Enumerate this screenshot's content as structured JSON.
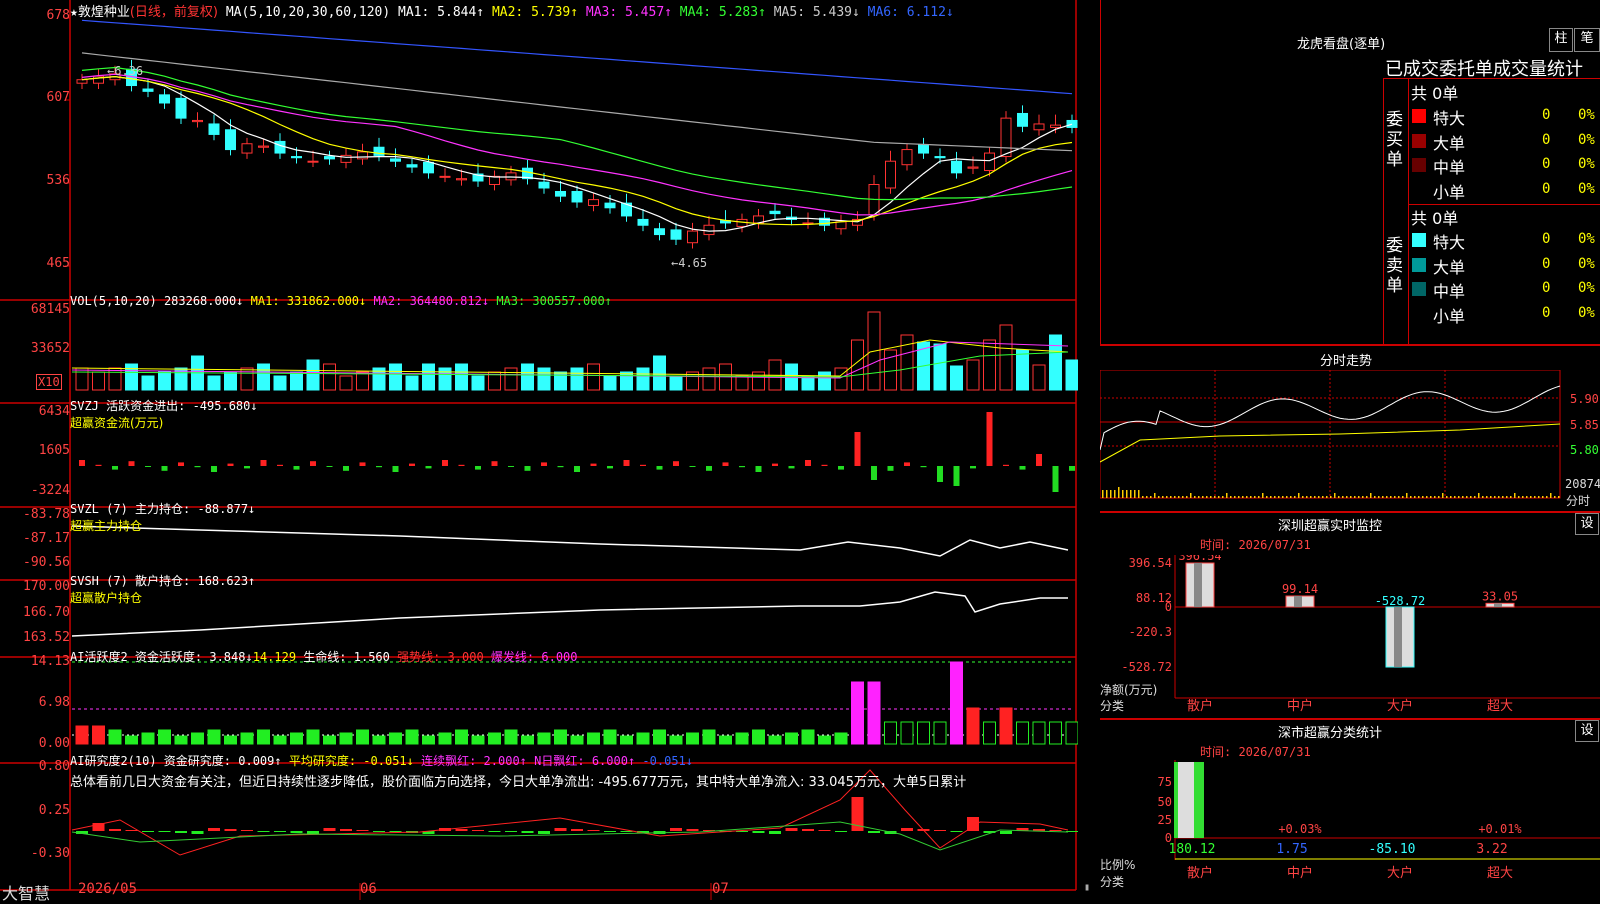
{
  "main": {
    "header": {
      "star": "★",
      "stock": "敦煌种业",
      "mode": "(日线，前复权)",
      "ma_params": "MA(5,10,20,30,60,120)",
      "ma1": "MA1: 5.844↑",
      "ma2": "MA2: 5.739↑",
      "ma3": "MA3: 5.457↑",
      "ma4": "MA4: 5.283↑",
      "ma5": "MA5: 5.439↓",
      "ma6": "MA6: 6.112↓"
    },
    "y_labels": [
      "678",
      "607",
      "536",
      "465"
    ],
    "high_marker": "←6.36",
    "low_marker": "←4.65"
  },
  "vol": {
    "params": "VOL(5,10,20)",
    "value": "283268.000↓",
    "ma1": "MA1: 331862.000↓",
    "ma2": "MA2: 364480.812↓",
    "ma3": "MA3: 300557.000↑",
    "y_labels": [
      "68145",
      "33652"
    ],
    "unit": "X10"
  },
  "svzj": {
    "line1": "SVZJ  活跃资金进出: -495.680↓",
    "line2": "超赢资金流(万元)",
    "y_labels": [
      "6434",
      "1605",
      "-3224"
    ]
  },
  "svzl": {
    "line1": "SVZL (7) 主力持仓: -88.877↓",
    "line2": "超赢主力持仓",
    "y_labels": [
      "-83.78",
      "-87.17",
      "-90.56"
    ]
  },
  "svsh": {
    "line1": "SVSH (7) 散户持仓: 168.623↑",
    "line2": "超赢散户持仓",
    "y_labels": [
      "170.00",
      "166.70",
      "163.52"
    ]
  },
  "ai_active": {
    "title": "AI活跃度2 资金活跃度: 3.848↓",
    "v2": "14.129",
    "life": "生命线: 1.560",
    "strong": "强势线: 3.000",
    "burst": "爆发线: 6.000",
    "y_labels": [
      "14.13",
      "6.98",
      "0.00"
    ]
  },
  "ai_research": {
    "title": "AI研究度2(10) 资金研究度: 0.009↑",
    "avg": "平均研究度: -0.051↓",
    "consec": "连续飘红: 2.000↑",
    "nday": "N日飘红: 6.000↑",
    "extra": "-0.051↓",
    "summary": "总体看前几日大资金有关注，但近日持续性逐步降低，股价面临方向选择，今日大单净流出: -495.677万元，其中特大单净流入: 33.045万元，大单5日累计",
    "y_labels": [
      "0.80",
      "0.25",
      "-0.30"
    ]
  },
  "xaxis": {
    "brand": "大智慧",
    "months": [
      "2026/05",
      "06",
      "07"
    ]
  },
  "dragon": {
    "title": "龙虎看盘(逐单)",
    "btn1": "柱",
    "btn2": "笔",
    "subtitle": "已成交委托单成交量统计",
    "buy": {
      "side_label": "委买单",
      "total": "共 0单",
      "rows": [
        {
          "name": "特大",
          "count": "0",
          "pct": "0%",
          "color": "#ff0000"
        },
        {
          "name": "大单",
          "count": "0",
          "pct": "0%",
          "color": "#990000"
        },
        {
          "name": "中单",
          "count": "0",
          "pct": "0%",
          "color": "#660000"
        },
        {
          "name": "小单",
          "count": "0",
          "pct": "0%",
          "color": "#000000"
        }
      ]
    },
    "sell": {
      "side_label": "委卖单",
      "total": "共 0单",
      "rows": [
        {
          "name": "特大",
          "count": "0",
          "pct": "0%",
          "color": "#33ffff"
        },
        {
          "name": "大单",
          "count": "0",
          "pct": "0%",
          "color": "#009999"
        },
        {
          "name": "中单",
          "count": "0",
          "pct": "0%",
          "color": "#006666"
        },
        {
          "name": "小单",
          "count": "0",
          "pct": "0%",
          "color": "#000000"
        }
      ]
    }
  },
  "intraday": {
    "title": "分时走势",
    "prices": [
      "5.90",
      "5.85",
      "5.80"
    ],
    "vol_label": "20874",
    "vol_unit": "分时"
  },
  "sz_monitor": {
    "title": "深圳超赢实时监控",
    "btn": "设",
    "time": "时间: 2026/07/31",
    "y_labels": [
      "396.54",
      "88.12",
      "0",
      "-220.3",
      "-528.72"
    ],
    "axis_label": "净额(万元)",
    "cat_label": "分类",
    "bars": [
      {
        "name": "散户",
        "value": 396.54,
        "label": "396.54"
      },
      {
        "name": "中户",
        "value": 99.14,
        "label": "99.14"
      },
      {
        "name": "大户",
        "value": -528.72,
        "label": "-528.72"
      },
      {
        "name": "超大",
        "value": 33.05,
        "label": "33.05"
      }
    ]
  },
  "sz_class": {
    "title": "深市超赢分类统计",
    "btn": "设",
    "time": "时间: 2026/07/31",
    "y_labels": [
      "75",
      "50",
      "25",
      "0"
    ],
    "axis_label": "比例%",
    "cat_label": "分类",
    "cats": [
      {
        "name": "散户",
        "top": "",
        "bottom": "180.12"
      },
      {
        "name": "中户",
        "top": "+0.03%",
        "bottom": "1.75"
      },
      {
        "name": "大户",
        "top": "",
        "bottom": "-85.10"
      },
      {
        "name": "超大",
        "top": "+0.01%",
        "bottom": "3.22"
      }
    ]
  },
  "colors": {
    "up": "#ff3333",
    "down": "#33ffff",
    "grid": "#cc0000",
    "ma1": "#ffffff",
    "ma2": "#ffff00",
    "ma3": "#ff33ff",
    "ma4": "#33ff33",
    "ma5": "#aaaaaa",
    "ma6": "#3355ff"
  }
}
